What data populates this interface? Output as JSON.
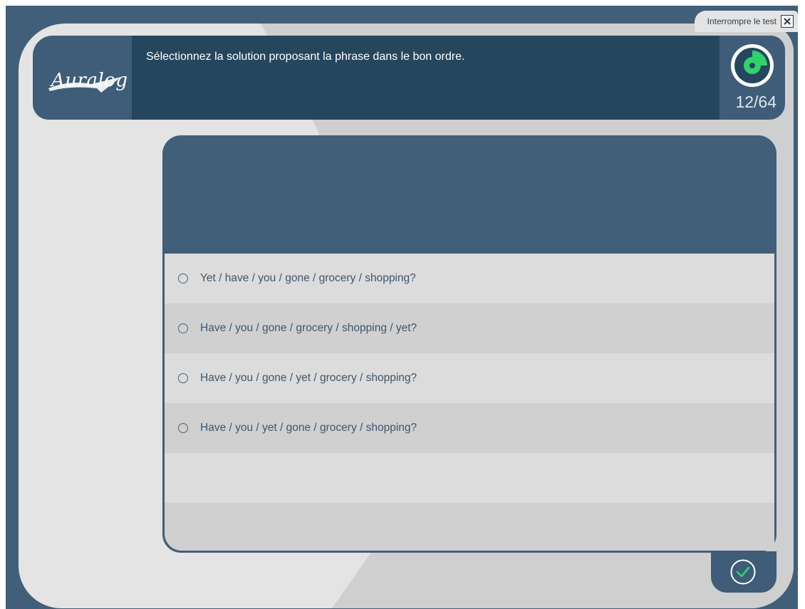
{
  "header": {
    "stop_label": "Interrompre le test",
    "logo_text": "Auralog",
    "instruction": "Sélectionnez la solution proposant la phrase dans le bon ordre.",
    "counter": "12/64",
    "timer_progress": 0.25
  },
  "question": {
    "prompt": ""
  },
  "options": [
    {
      "label": "Yet / have / you / gone / grocery / shopping?"
    },
    {
      "label": "Have / you / gone / grocery / shopping / yet?"
    },
    {
      "label": "Have / you / gone / yet / grocery / shopping?"
    },
    {
      "label": "Have / you / yet / gone / grocery / shopping?"
    }
  ],
  "icons": {
    "close": "close-icon",
    "timer": "timer-icon",
    "validate": "checkmark-icon",
    "radio": "radio-icon"
  },
  "colors": {
    "frame": "#415f79",
    "header_dark": "#25475e",
    "timer_green": "#2fd36b",
    "text_option": "#3f566d"
  }
}
